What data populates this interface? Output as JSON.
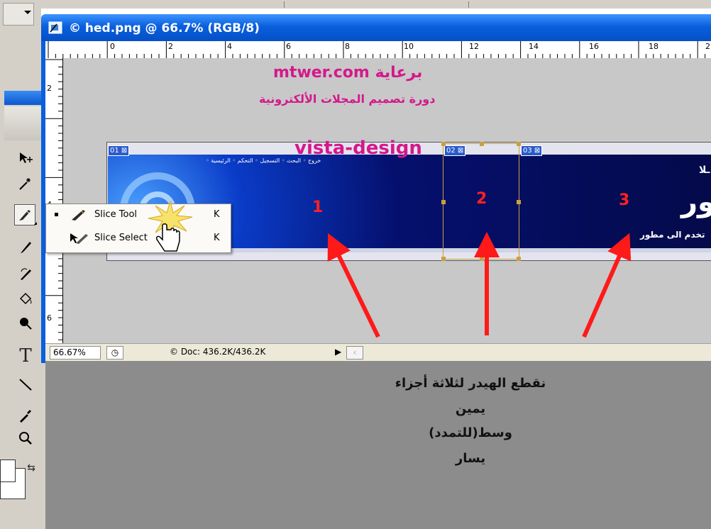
{
  "document": {
    "title": "© hed.png @ 66.7% (RGB/8)",
    "zoom": "66.67%",
    "doc_size": "© Doc: 436.2K/436.2K"
  },
  "rulers": {
    "h_ticks": [
      "0",
      "2",
      "4",
      "6",
      "8",
      "10",
      "12",
      "14",
      "16",
      "18",
      "2"
    ],
    "v_ticks": [
      "2",
      "4",
      "6"
    ]
  },
  "canvas_texts": {
    "site_title": "mtwer.com برعاية",
    "course": "دورة تصميم المجلات الألكترونية",
    "watermark": "vista-design"
  },
  "banner": {
    "slice_tags": [
      "01",
      "02",
      "03"
    ],
    "slice_numbers": [
      "1",
      "2",
      "3"
    ],
    "nav_left": "◦ خروج ◦ البحث ◦ التسجيل ◦ التحكم ◦ الرئيسية",
    "big_text": "ور",
    "sub_text": "تخدم الى مطور",
    "top_letter": "ـلا"
  },
  "context_menu": {
    "items": [
      {
        "label": "Slice Tool",
        "shortcut": "K",
        "selected": true
      },
      {
        "label": "Slice Select",
        "shortcut": "K",
        "selected": false
      }
    ]
  },
  "notes": {
    "line1": "نقطع الهيدر لثلاثة أجزاء",
    "line2": "يمين",
    "line3": "وسط(للتمدد)",
    "line4": "يسار"
  },
  "colors": {
    "accent": "#d4188c",
    "arrow": "#ff1a1a",
    "titlebar": "#0a5fdd",
    "slice_border": "#c8a040"
  },
  "icons": [
    "move-icon",
    "magic-wand-icon",
    "slice-tool-icon",
    "brush-icon",
    "history-brush-icon",
    "paint-bucket-icon",
    "dodge-icon",
    "type-icon",
    "line-icon",
    "eyedropper-icon",
    "zoom-icon",
    "swap-colors-icon"
  ]
}
